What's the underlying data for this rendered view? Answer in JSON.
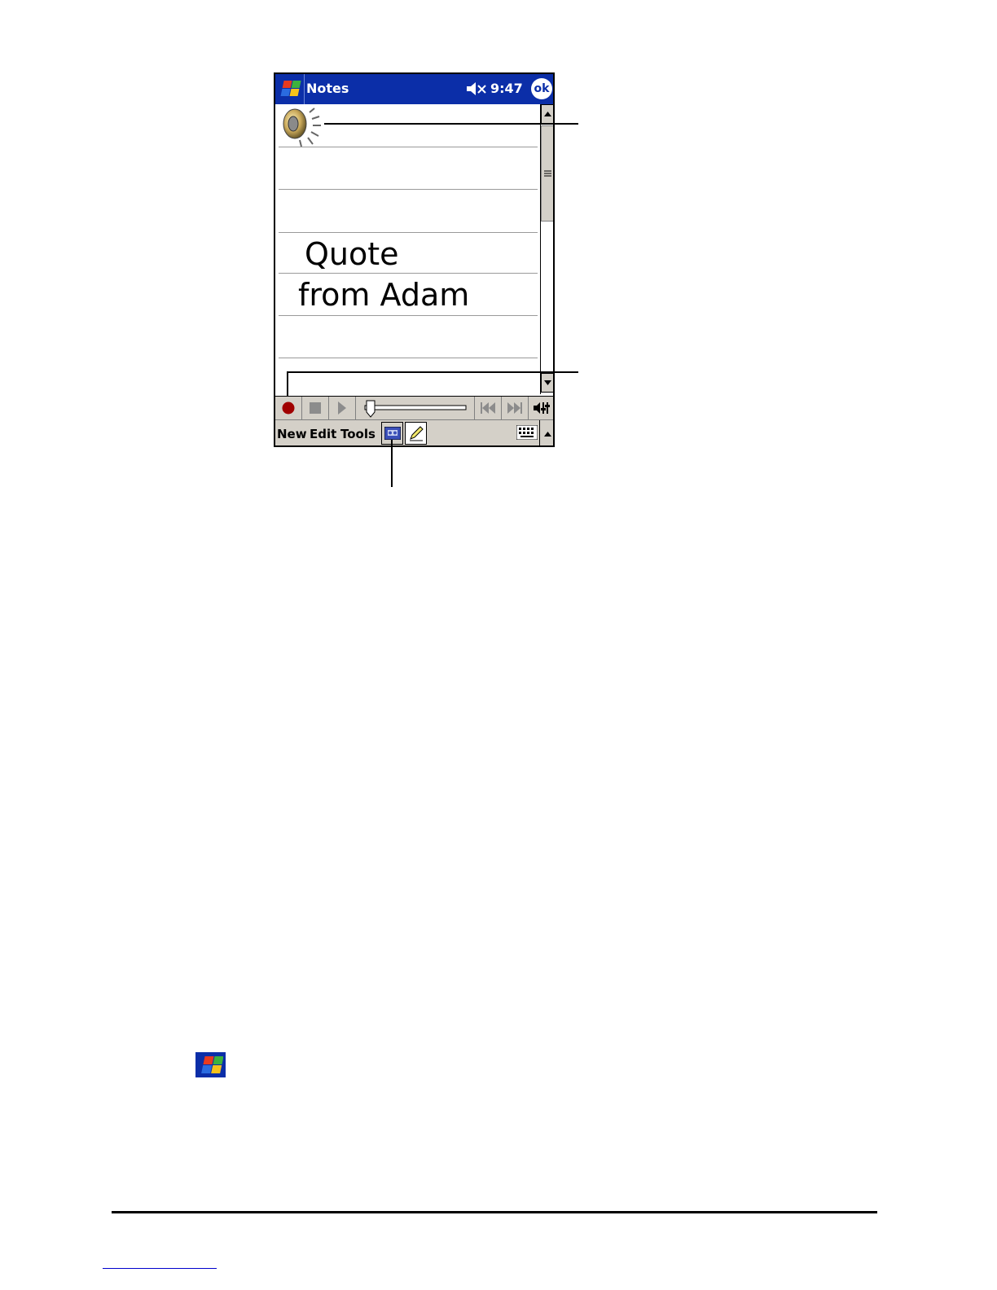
{
  "device": {
    "title": "Notes",
    "clock": "9:47",
    "ok_label": "ok"
  },
  "note": {
    "lines": [
      "Quote",
      "from Adam"
    ]
  },
  "menu": {
    "items": [
      "New",
      "Edit",
      "Tools"
    ]
  },
  "colors": {
    "titlebar": "#0b2ea8",
    "chrome": "#d4d0c8",
    "record": "#a00000"
  },
  "icons": [
    "windows-start-icon",
    "speaker-mute-icon",
    "voice-note-icon",
    "record-icon",
    "stop-icon",
    "play-icon",
    "rewind-icon",
    "fast-forward-icon",
    "volume-icon",
    "recording-toolbar-icon",
    "pen-icon",
    "keyboard-icon"
  ]
}
